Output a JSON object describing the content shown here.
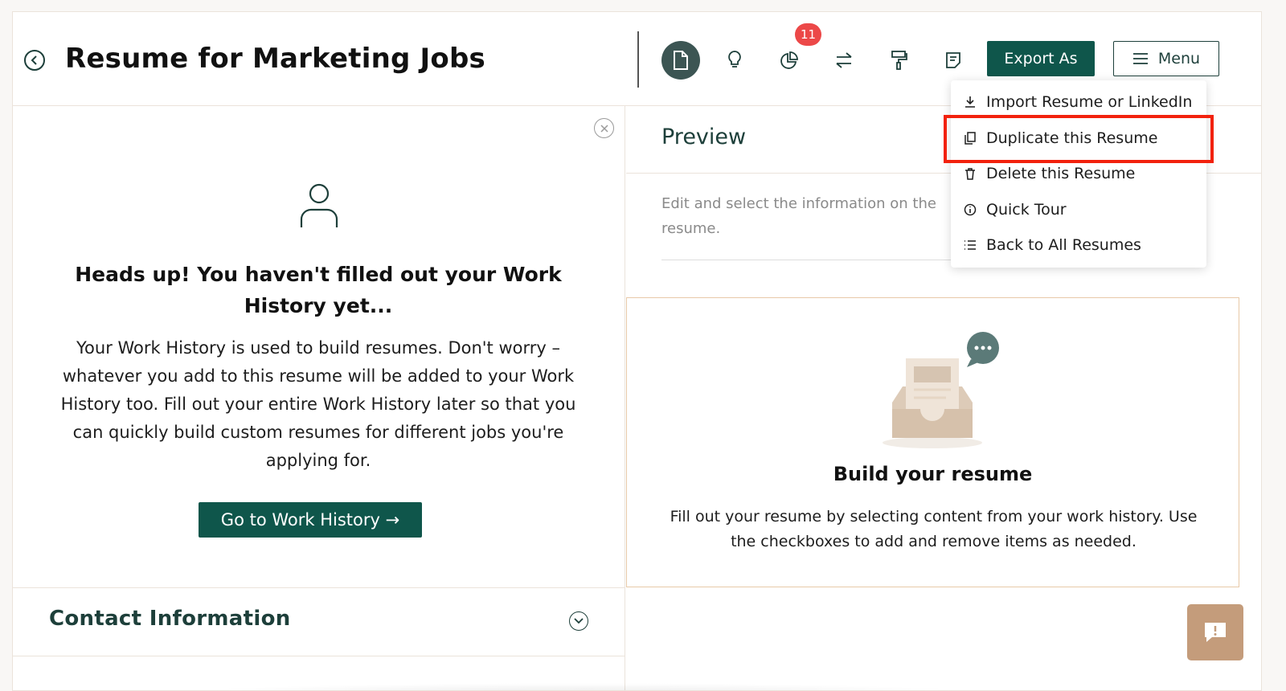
{
  "header": {
    "title": "Resume for Marketing Jobs",
    "badge_count": "11",
    "export_label": "Export As",
    "menu_label": "Menu",
    "toolbar_icons": [
      "document-icon",
      "lightbulb-icon",
      "pie-chart-icon",
      "swap-icon",
      "paint-roller-icon",
      "note-icon"
    ]
  },
  "dropdown": {
    "items": [
      {
        "label": "Import Resume or LinkedIn",
        "icon": "download-icon"
      },
      {
        "label": "Duplicate this Resume",
        "icon": "copy-icon"
      },
      {
        "label": "Delete this Resume",
        "icon": "trash-icon"
      },
      {
        "label": "Quick Tour",
        "icon": "info-icon"
      },
      {
        "label": "Back to All Resumes",
        "icon": "list-icon"
      }
    ]
  },
  "notice": {
    "title": "Heads up! You haven't filled out your Work History yet...",
    "body": "Your Work History is used to build resumes. Don't worry – whatever you add to this resume will be added to your Work History too. Fill out your entire Work History later so that you can quickly build custom resumes for different jobs you're applying for.",
    "button_label": "Go to Work History →"
  },
  "contact": {
    "title": "Contact Information"
  },
  "preview": {
    "title": "Preview",
    "description": "Edit and select the information on the resume."
  },
  "build_card": {
    "title": "Build your resume",
    "body": "Fill out your resume by selecting content from your work history. Use the checkboxes to add and remove items as needed."
  },
  "colors": {
    "primary": "#0f564b",
    "badge": "#ec4848",
    "highlight": "#f2210d",
    "accent_tan": "#c49c7b"
  }
}
